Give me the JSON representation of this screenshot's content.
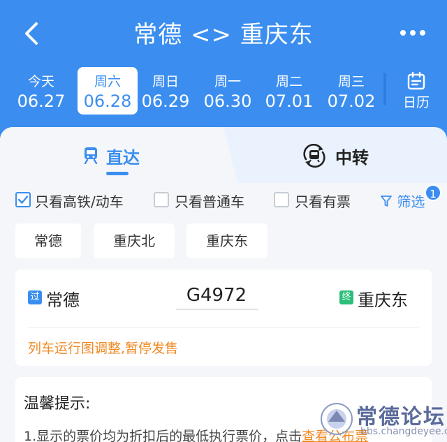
{
  "header": {
    "title": "常德 <> 重庆东",
    "back_icon": "chevron-left-icon",
    "more_icon": "more-horizontal-icon",
    "bg_color": "#3b8ef0"
  },
  "dates": [
    {
      "weekday": "今天",
      "date": "06.27",
      "active": false
    },
    {
      "weekday": "周六",
      "date": "06.28",
      "active": true
    },
    {
      "weekday": "周日",
      "date": "06.29",
      "active": false
    },
    {
      "weekday": "周一",
      "date": "06.30",
      "active": false
    },
    {
      "weekday": "周二",
      "date": "07.01",
      "active": false
    },
    {
      "weekday": "周三",
      "date": "07.02",
      "active": false
    }
  ],
  "calendar": {
    "label": "日历",
    "icon": "calendar-icon"
  },
  "tabs": {
    "direct": {
      "label": "直达",
      "icon": "train-icon",
      "active": true
    },
    "transfer": {
      "label": "中转",
      "icon": "transfer-train-icon",
      "active": false
    }
  },
  "filters": {
    "highspeed": {
      "label": "只看高铁/动车",
      "checked": true
    },
    "normal": {
      "label": "只看普通车",
      "checked": false
    },
    "available": {
      "label": "只看有票",
      "checked": false
    },
    "filter_button": {
      "label": "筛选",
      "badge": "1",
      "icon": "filter-icon"
    }
  },
  "stations": [
    "常德",
    "重庆北",
    "重庆东"
  ],
  "train": {
    "from_tag": "过",
    "from": "常德",
    "number": "G4972",
    "to_tag": "终",
    "to": "重庆东",
    "notice": "列车运行图调整,暂停发售",
    "from_tag_color": "#3b8ef0",
    "to_tag_color": "#2bbf7a"
  },
  "tips": {
    "title": "温馨提示:",
    "line1_prefix": "1.显示的票价均为折扣后的最低执行票价，点击",
    "line1_link": "查看公布票"
  },
  "watermark": {
    "text": "常德论坛",
    "url": "bbs.changdeyee.com"
  }
}
